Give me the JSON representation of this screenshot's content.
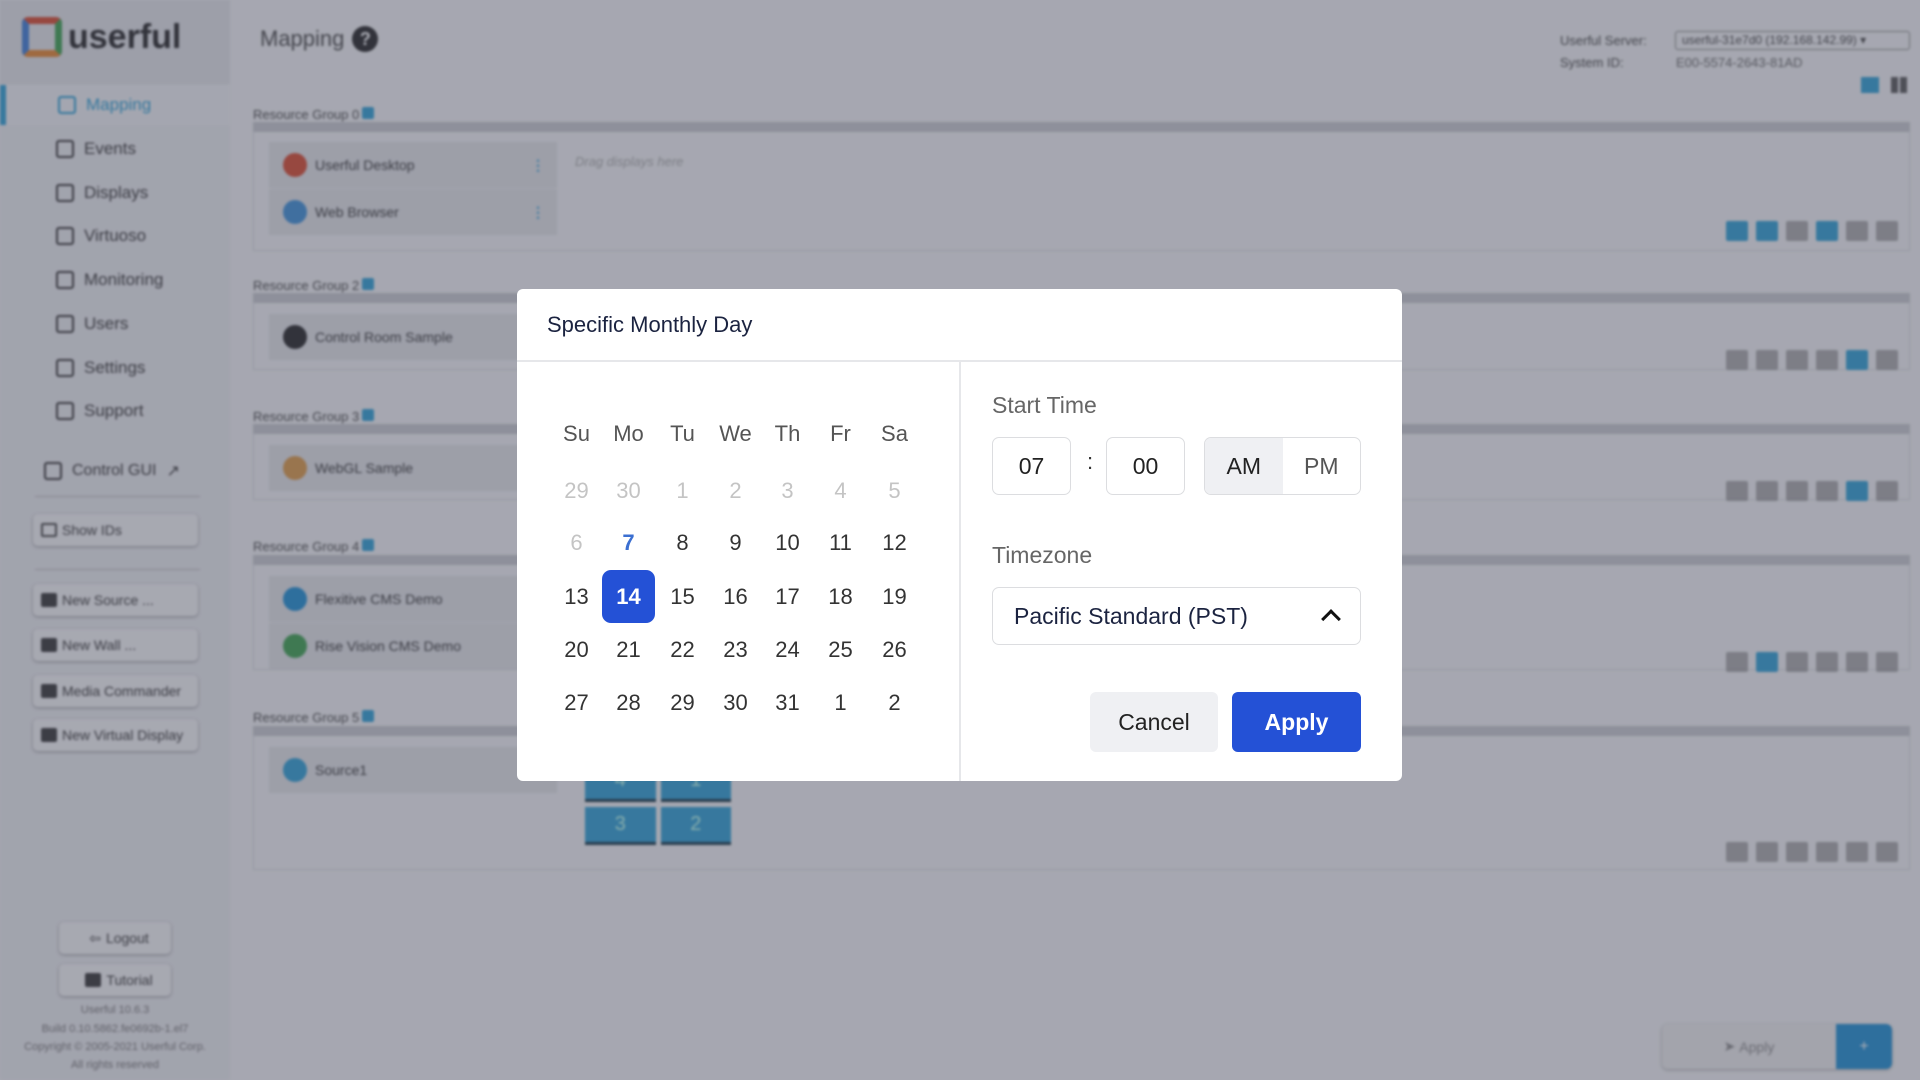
{
  "app": {
    "logo_text": "userful",
    "page_title": "Mapping",
    "help_icon": "?"
  },
  "header": {
    "server_label": "Userful Server:",
    "server_value": "userful-31e7d0 (192.168.142.99)",
    "system_id_label": "System ID:",
    "system_id_value": "E00-5574-2643-81AD"
  },
  "sidebar": {
    "items": [
      {
        "label": "Mapping",
        "active": true
      },
      {
        "label": "Events"
      },
      {
        "label": "Displays"
      },
      {
        "label": "Virtuoso"
      },
      {
        "label": "Monitoring"
      },
      {
        "label": "Users"
      },
      {
        "label": "Settings"
      },
      {
        "label": "Support"
      }
    ],
    "control_gui": "Control GUI",
    "show_ids": "Show IDs",
    "actions": [
      "New Source ...",
      "New Wall ...",
      "Media Commander",
      "New Virtual Display"
    ],
    "logout": "Logout",
    "tutorial": "Tutorial",
    "version": [
      "Userful 10.6.3",
      "Build 0.10.5862.fe0692b-1.el7",
      "Copyright © 2005-2021 Userful Corp.",
      "All rights reserved"
    ]
  },
  "groups": [
    {
      "label": "Resource Group 0",
      "sources": [
        "Userful Desktop",
        "Web Browser"
      ],
      "placeholder": "Drag displays here"
    },
    {
      "label": "Resource Group 2",
      "sources": [
        "Control Room Sample"
      ]
    },
    {
      "label": "Resource Group 3",
      "sources": [
        "WebGL Sample"
      ]
    },
    {
      "label": "Resource Group 4",
      "sources": [
        "Flexitive CMS Demo",
        "Rise Vision CMS Demo"
      ]
    },
    {
      "label": "Resource Group 5",
      "sources": [
        "Source1"
      ],
      "wall_tiles": [
        "4",
        "1",
        "3",
        "2"
      ]
    }
  ],
  "footer": {
    "apply": "Apply",
    "add": "+"
  },
  "modal": {
    "title": "Specific Monthly Day",
    "weekdays": [
      "Su",
      "Mo",
      "Tu",
      "We",
      "Th",
      "Fr",
      "Sa"
    ],
    "days": [
      [
        "29",
        "30",
        "1",
        "2",
        "3",
        "4",
        "5"
      ],
      [
        "6",
        "7",
        "8",
        "9",
        "10",
        "11",
        "12"
      ],
      [
        "13",
        "14",
        "15",
        "16",
        "17",
        "18",
        "19"
      ],
      [
        "20",
        "21",
        "22",
        "23",
        "24",
        "25",
        "26"
      ],
      [
        "27",
        "28",
        "29",
        "30",
        "31",
        "1",
        "2"
      ]
    ],
    "today": "7",
    "selected": "14",
    "start_time_label": "Start Time",
    "hour": "07",
    "colon": ":",
    "minute": "00",
    "am": "AM",
    "pm": "PM",
    "meridiem": "AM",
    "timezone_label": "Timezone",
    "timezone": "Pacific Standard (PST)",
    "cancel": "Cancel",
    "apply": "Apply"
  },
  "colors": {
    "accent": "#2451d6",
    "brand": "#2a9fd6"
  }
}
